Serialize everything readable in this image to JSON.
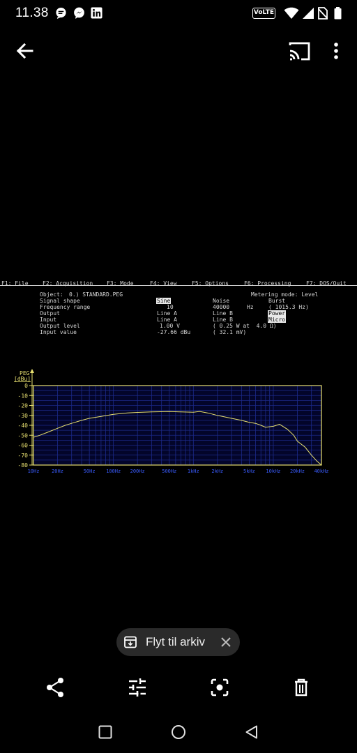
{
  "status_bar": {
    "time": "11.38",
    "apps": [
      "chat-bubble-icon",
      "messenger-icon",
      "linkedin-icon"
    ],
    "volte": "VoLTE",
    "icons": [
      "wifi-icon",
      "signal-icon",
      "no-sim-icon",
      "battery-icon"
    ]
  },
  "app_bar": {
    "back_icon": "arrow-back-icon",
    "cast_icon": "cast-icon",
    "more_icon": "more-vert-icon"
  },
  "dos_screen": {
    "menu": [
      "F1: File",
      "F2: Acquisition",
      "F3: Mode",
      "F4: View",
      "F5: Options",
      "F6: Processing",
      "F7: DOS/Quit"
    ],
    "object_label": "Object:",
    "object_value": "0.) STANDARD.PEG",
    "metering_mode": "Metering mode: Level",
    "rows": [
      {
        "label": "Signal shape",
        "col_a": "Sine",
        "col_b": "Noise",
        "col_c": "Burst"
      },
      {
        "label": "Frequency range",
        "col_a": "10",
        "col_b": "40000",
        "col_b_unit": "Hz",
        "col_c": "( 1015.3 Hz)"
      },
      {
        "label": "Output",
        "col_a": "Line A",
        "col_b": "Line B",
        "col_c": "Power"
      },
      {
        "label": "Input",
        "col_a": "Line A",
        "col_b": "Line B",
        "col_c": "Micro"
      },
      {
        "label": "Output level",
        "col_a": "1.00 V",
        "col_b": "( 0.25 W at  4.0 Ω)"
      },
      {
        "label": "Input value",
        "col_a": "-27.66 dBu",
        "col_b": "( 32.1 mV)"
      }
    ]
  },
  "chart_data": {
    "type": "line",
    "title": "",
    "y_axis_title": "PEG",
    "y_unit": "[dBu]",
    "xlabel": "",
    "ylabel": "[dBu]",
    "x_scale": "log",
    "xlim": [
      10,
      40000
    ],
    "ylim": [
      -80,
      0
    ],
    "y_ticks": [
      "0",
      "-10",
      "-20",
      "-30",
      "-40",
      "-50",
      "-60",
      "-70",
      "-80"
    ],
    "x_tick_labels": [
      "10Hz",
      "20Hz",
      "50Hz",
      "100Hz",
      "200Hz",
      "500Hz",
      "1kHz",
      "2kHz",
      "5kHz",
      "10kHz",
      "20kHz",
      "40kHz"
    ],
    "x_tick_values": [
      10,
      20,
      50,
      100,
      200,
      500,
      1000,
      2000,
      5000,
      10000,
      20000,
      40000
    ],
    "grid": true,
    "colors": {
      "line": "#e8e070",
      "axis": "#e8e070",
      "grid": "#1c2a8a",
      "ticks": "#3a5cff"
    },
    "series": [
      {
        "x": [
          10,
          12,
          15,
          20,
          25,
          30,
          40,
          50,
          70,
          100,
          150,
          200,
          300,
          500,
          700,
          1000,
          1200,
          1500,
          2000,
          3000,
          4000,
          5000,
          6000,
          7000,
          8000,
          10000,
          12000,
          15000,
          18000,
          20000,
          25000,
          30000,
          35000,
          40000
        ],
        "values": [
          -52,
          -50,
          -47,
          -43,
          -40,
          -38,
          -35,
          -33,
          -31,
          -29,
          -27.5,
          -27,
          -26.5,
          -26.2,
          -26.5,
          -26.8,
          -26,
          -27.5,
          -30,
          -33,
          -35,
          -37,
          -38,
          -40,
          -42,
          -41,
          -39,
          -44,
          -50,
          -56,
          -62,
          -70,
          -76,
          -80
        ]
      }
    ]
  },
  "toast": {
    "icon": "archive-icon",
    "label": "Flyt til arkiv",
    "close_icon": "close-icon"
  },
  "actions": [
    "share-icon",
    "tune-icon",
    "lens-icon",
    "delete-icon"
  ],
  "nav": [
    "recents-icon",
    "home-icon",
    "back-nav-icon"
  ]
}
